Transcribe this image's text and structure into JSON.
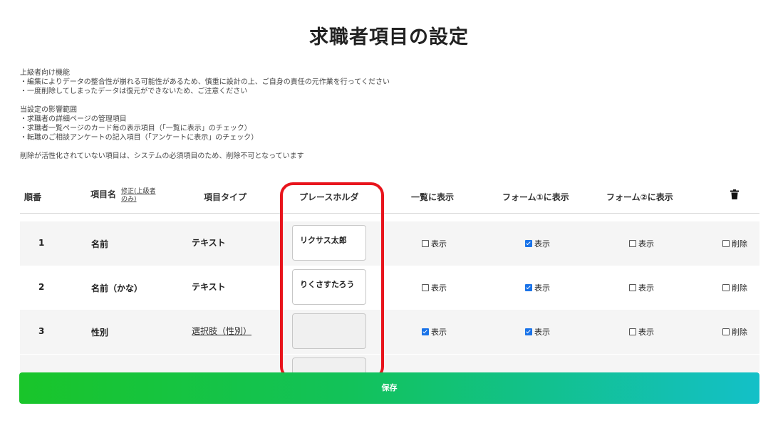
{
  "page": {
    "title": "求職者項目の設定"
  },
  "notes": {
    "lines1": [
      "上級者向け機能",
      "・編集によりデータの整合性が崩れる可能性があるため、慎重に設計の上、ご自身の責任の元作業を行ってください",
      "・一度削除してしまったデータは復元ができないため、ご注意ください"
    ],
    "lines2": [
      "当設定の影響範囲",
      "・求職者の詳細ページの管理項目",
      "・求職者一覧ページのカード毎の表示項目（「一覧に表示」のチェック）",
      "・転職のご相談アンケートの記入項目（「アンケートに表示」のチェック）"
    ],
    "line3": "削除が活性化されていない項目は、システムの必須項目のため、削除不可となっています"
  },
  "table": {
    "headers": {
      "order": "順番",
      "name": "項目名",
      "name_edit": "修正(上級者のみ)",
      "type": "項目タイプ",
      "placeholder": "プレースホルダ",
      "list": "一覧に表示",
      "form1": "フォーム①に表示",
      "form2": "フォーム②に表示"
    },
    "show_label": "表示",
    "delete_label": "削除",
    "rows": [
      {
        "num": "1",
        "name": "名前",
        "type": "テキスト",
        "placeholder": "リクサス太郎",
        "list": false,
        "form1": true,
        "form2": false,
        "delete": false
      },
      {
        "num": "2",
        "name": "名前（かな）",
        "type": "テキスト",
        "placeholder": "りくさすたろう",
        "list": false,
        "form1": true,
        "form2": false,
        "delete": false
      },
      {
        "num": "3",
        "name": "性別",
        "type": "選択肢（性別）",
        "placeholder": "",
        "list": true,
        "form1": true,
        "form2": false,
        "delete": false
      }
    ]
  },
  "save_button": {
    "label": "保存"
  },
  "colors": {
    "highlight": "#e8141c",
    "checkbox_on": "#1a73e8",
    "save_start": "#19c52a",
    "save_end": "#13c0c8"
  },
  "icons": {
    "delete_header": "trash-icon"
  }
}
